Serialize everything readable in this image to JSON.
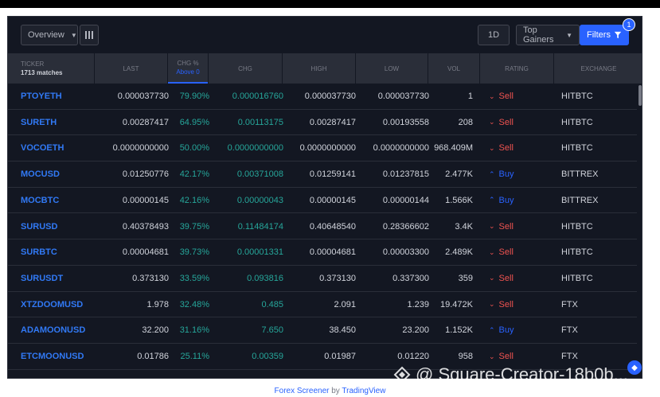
{
  "toolbar": {
    "overview_label": "Overview",
    "interval_label": "1D",
    "gainers_label": "Top Gainers",
    "filters_label": "Filters",
    "filters_badge": "1"
  },
  "header": {
    "ticker": "TICKER",
    "matches": "1713 matches",
    "last": "LAST",
    "chg_pct": "CHG %",
    "chg_pct_sub": "Above 0",
    "chg": "CHG",
    "high": "HIGH",
    "low": "LOW",
    "vol": "VOL",
    "rating": "RATING",
    "exchange": "EXCHANGE"
  },
  "rows": [
    {
      "ticker": "PTOYETH",
      "last": "0.000037730",
      "chg_pct": "79.90%",
      "chg": "0.000016760",
      "high": "0.000037730",
      "low": "0.000037730",
      "vol": "1",
      "rating": "Sell",
      "exchange": "HITBTC"
    },
    {
      "ticker": "SURETH",
      "last": "0.00287417",
      "chg_pct": "64.95%",
      "chg": "0.00113175",
      "high": "0.00287417",
      "low": "0.00193558",
      "vol": "208",
      "rating": "Sell",
      "exchange": "HITBTC"
    },
    {
      "ticker": "VOCOETH",
      "last": "0.0000000000",
      "chg_pct": "50.00%",
      "chg": "0.0000000000",
      "high": "0.0000000000",
      "low": "0.0000000000",
      "vol": "968.409M",
      "rating": "Sell",
      "exchange": "HITBTC"
    },
    {
      "ticker": "MOCUSD",
      "last": "0.01250776",
      "chg_pct": "42.17%",
      "chg": "0.00371008",
      "high": "0.01259141",
      "low": "0.01237815",
      "vol": "2.477K",
      "rating": "Buy",
      "exchange": "BITTREX"
    },
    {
      "ticker": "MOCBTC",
      "last": "0.00000145",
      "chg_pct": "42.16%",
      "chg": "0.00000043",
      "high": "0.00000145",
      "low": "0.00000144",
      "vol": "1.566K",
      "rating": "Buy",
      "exchange": "BITTREX"
    },
    {
      "ticker": "SURUSD",
      "last": "0.40378493",
      "chg_pct": "39.75%",
      "chg": "0.11484174",
      "high": "0.40648540",
      "low": "0.28366602",
      "vol": "3.4K",
      "rating": "Sell",
      "exchange": "HITBTC"
    },
    {
      "ticker": "SURBTC",
      "last": "0.00004681",
      "chg_pct": "39.73%",
      "chg": "0.00001331",
      "high": "0.00004681",
      "low": "0.00003300",
      "vol": "2.489K",
      "rating": "Sell",
      "exchange": "HITBTC"
    },
    {
      "ticker": "SURUSDT",
      "last": "0.373130",
      "chg_pct": "33.59%",
      "chg": "0.093816",
      "high": "0.373130",
      "low": "0.337300",
      "vol": "359",
      "rating": "Sell",
      "exchange": "HITBTC"
    },
    {
      "ticker": "XTZDOOMUSD",
      "last": "1.978",
      "chg_pct": "32.48%",
      "chg": "0.485",
      "high": "2.091",
      "low": "1.239",
      "vol": "19.472K",
      "rating": "Sell",
      "exchange": "FTX"
    },
    {
      "ticker": "ADAMOONUSD",
      "last": "32.200",
      "chg_pct": "31.16%",
      "chg": "7.650",
      "high": "38.450",
      "low": "23.200",
      "vol": "1.152K",
      "rating": "Buy",
      "exchange": "FTX"
    },
    {
      "ticker": "ETCMOONUSD",
      "last": "0.01786",
      "chg_pct": "25.11%",
      "chg": "0.00359",
      "high": "0.01987",
      "low": "0.01220",
      "vol": "958",
      "rating": "Sell",
      "exchange": "FTX"
    }
  ],
  "footer": {
    "product": "Forex Screener",
    "by": " by ",
    "brand": "TradingView"
  },
  "watermark": "@ Square-Creator-18b0b...",
  "colors": {
    "background": "#131722",
    "accent": "#2962ff",
    "positive": "#26a69a",
    "negative": "#ef5350"
  }
}
